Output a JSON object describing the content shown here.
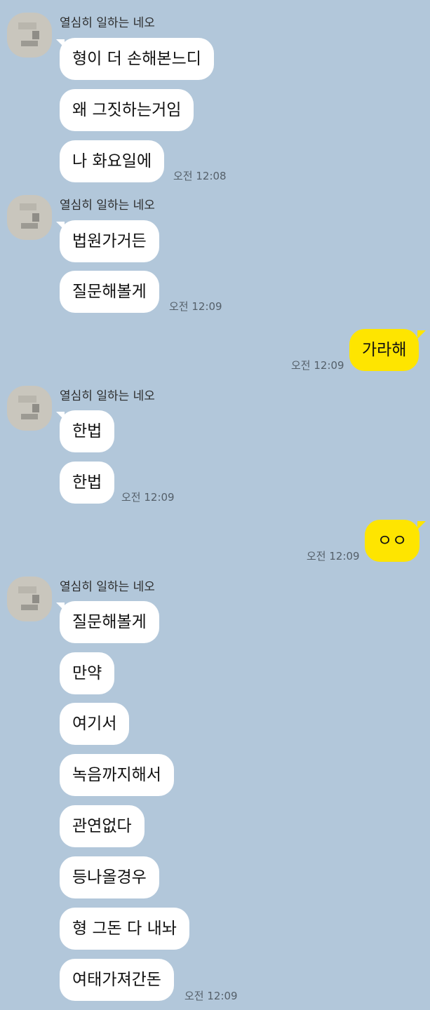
{
  "colors": {
    "background": "#b2c7da",
    "incoming_bubble": "#ffffff",
    "outgoing_bubble": "#fee500"
  },
  "sender_name": "열심히 일하는 네오",
  "groups": [
    {
      "type": "incoming",
      "messages": [
        "형이 더 손해본느디",
        "왜 그짓하는거임",
        "나 화요일에"
      ],
      "time": "오전 12:08"
    },
    {
      "type": "incoming",
      "messages": [
        "법원가거든",
        "질문해볼게"
      ],
      "time": "오전 12:09"
    },
    {
      "type": "outgoing",
      "messages": [
        "가라해"
      ],
      "time": "오전 12:09"
    },
    {
      "type": "incoming",
      "messages": [
        "한법",
        "한법"
      ],
      "time": "오전 12:09"
    },
    {
      "type": "outgoing",
      "messages": [
        "ㅇㅇ"
      ],
      "time": "오전 12:09"
    },
    {
      "type": "incoming",
      "messages": [
        "질문해볼게",
        "만약",
        "여기서",
        "녹음까지해서",
        "관연없다",
        "등나올경우",
        "형 그돈 다 내놔",
        "여태가져간돈"
      ],
      "time": "오전 12:09"
    }
  ]
}
